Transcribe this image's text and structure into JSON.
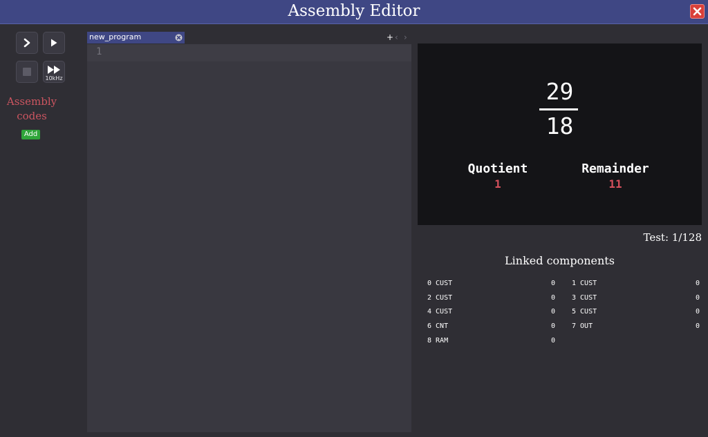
{
  "window": {
    "title": "Assembly Editor"
  },
  "controls": {
    "speed_label": "10kHz"
  },
  "sidebar": {
    "heading_line1": "Assembly",
    "heading_line2": "codes",
    "add_label": "Add"
  },
  "tabs": [
    {
      "label": "new_program"
    }
  ],
  "tab_nav": {
    "plus": "+",
    "prev": "‹",
    "next": "›"
  },
  "editor": {
    "lines": [
      "1"
    ]
  },
  "display": {
    "numerator": "29",
    "denominator": "18",
    "quotient_label": "Quotient",
    "quotient_value": "1",
    "remainder_label": "Remainder",
    "remainder_value": "11"
  },
  "test_status": "Test: 1/128",
  "linked_components": {
    "title": "Linked components",
    "items": [
      {
        "name": "0 CUST",
        "value": "0"
      },
      {
        "name": "1 CUST",
        "value": "0"
      },
      {
        "name": "2 CUST",
        "value": "0"
      },
      {
        "name": "3 CUST",
        "value": "0"
      },
      {
        "name": "4 CUST",
        "value": "0"
      },
      {
        "name": "5 CUST",
        "value": "0"
      },
      {
        "name": "6 CNT",
        "value": "0"
      },
      {
        "name": "7 OUT",
        "value": "0"
      },
      {
        "name": "8 RAM",
        "value": "0"
      }
    ]
  },
  "colors": {
    "title_bar": "#3f4784",
    "accent_red": "#d5505c",
    "add_green": "#2fa53a",
    "close_red": "#d9403a"
  }
}
